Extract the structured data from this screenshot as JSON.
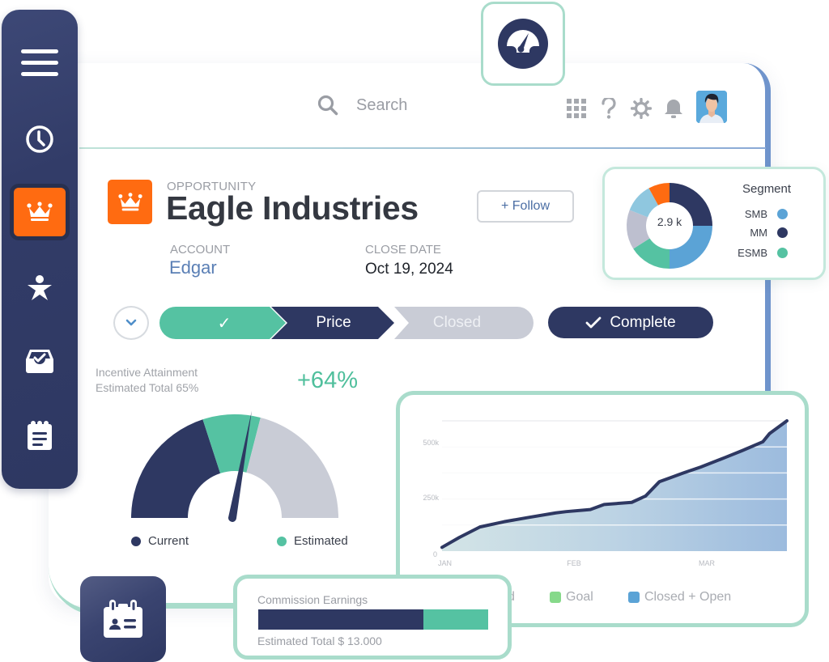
{
  "header": {
    "search_placeholder": "Search",
    "icons": [
      "apps-grid-icon",
      "help-icon",
      "settings-icon",
      "notifications-bell-icon",
      "user-avatar"
    ]
  },
  "sidebar": {
    "items": [
      {
        "name": "menu",
        "icon": "hamburger-menu-icon",
        "active": false
      },
      {
        "name": "recent",
        "icon": "clock-icon",
        "active": false
      },
      {
        "name": "opportunities",
        "icon": "crown-icon",
        "active": true
      },
      {
        "name": "people",
        "icon": "person-star-icon",
        "active": false
      },
      {
        "name": "inbox",
        "icon": "inbox-check-icon",
        "active": false
      },
      {
        "name": "notes",
        "icon": "notepad-icon",
        "active": false
      }
    ]
  },
  "opportunity": {
    "label": "OPPORTUNITY",
    "title": "Eagle Industries",
    "follow_label": "+ Follow",
    "account_label": "ACCOUNT",
    "account_value": "Edgar",
    "close_date_label": "CLOSE DATE",
    "close_date_value": "Oct 19, 2024"
  },
  "path": {
    "steps": [
      {
        "label": "✓",
        "state": "done"
      },
      {
        "label": "Price",
        "state": "current"
      },
      {
        "label": "Closed",
        "state": "upcoming"
      }
    ],
    "complete_label": "Complete"
  },
  "gauge": {
    "title_line1": "Incentive Attainment",
    "title_line2": "Estimated Total 65%",
    "delta": "+64%",
    "current_fraction": 0.4,
    "estimated_fraction": 0.58,
    "needle_fraction": 0.55,
    "legend": [
      {
        "label": "Current",
        "color": "#2e3862"
      },
      {
        "label": "Estimated",
        "color": "#55c2a2"
      }
    ]
  },
  "segment": {
    "title": "Segment",
    "center_label": "2.9 k",
    "legend": [
      {
        "label": "SMB",
        "color": "#5ba3d6"
      },
      {
        "label": "MM",
        "color": "#2e3862"
      },
      {
        "label": "ESMB",
        "color": "#55c2a2"
      }
    ],
    "slices": [
      {
        "color": "#2e3862",
        "share": 0.25
      },
      {
        "color": "#5ba3d6",
        "share": 0.25
      },
      {
        "color": "#55c2a2",
        "share": 0.16
      },
      {
        "color": "#bdbfcf",
        "share": 0.15
      },
      {
        "color": "#8fc7df",
        "share": 0.11
      },
      {
        "color": "#ff6b11",
        "share": 0.08
      }
    ]
  },
  "chart_data": {
    "type": "area",
    "title": "",
    "xlabel": "",
    "ylabel": "",
    "x_ticks": [
      "JAN",
      "FEB",
      "MAR"
    ],
    "y_ticks": [
      "0",
      "250k",
      "500k"
    ],
    "ylim": [
      0,
      620000
    ],
    "grid": true,
    "legend_position": "bottom",
    "legend": [
      {
        "label": "Closed",
        "color": "#2e3862"
      },
      {
        "label": "Goal",
        "color": "#86d98a"
      },
      {
        "label": "Closed + Open",
        "color": "#5ba3d6"
      }
    ],
    "series": [
      {
        "name": "Closed + Open",
        "x": [
          0,
          0.05,
          0.11,
          0.18,
          0.25,
          0.33,
          0.36,
          0.43,
          0.47,
          0.55,
          0.59,
          0.63,
          0.66,
          0.7,
          0.75,
          0.82,
          0.87,
          0.93,
          0.95,
          1.0
        ],
        "y": [
          18000,
          65000,
          115000,
          140000,
          160000,
          182000,
          188000,
          198000,
          222000,
          232000,
          262000,
          330000,
          348000,
          372000,
          400000,
          445000,
          478000,
          520000,
          560000,
          620000
        ]
      }
    ]
  },
  "commission": {
    "title": "Commission Earnings",
    "total_label": "Estimated Total $ 13.000",
    "current_fraction": 0.72
  },
  "colors": {
    "navy": "#2e3862",
    "teal": "#55c2a2",
    "orange": "#ff6b11",
    "gray": "#c9ccd6",
    "blue_accent": "#6f94cc"
  }
}
